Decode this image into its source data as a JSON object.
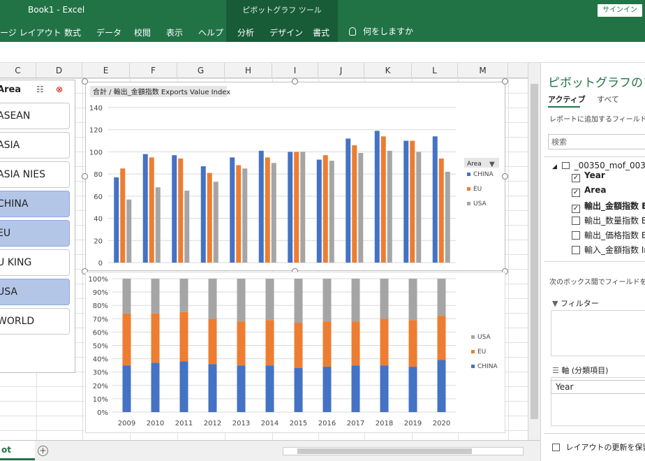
{
  "window": {
    "doc_title": "Book1 - Excel",
    "context_tab_group": "ピボットグラフ ツール",
    "signin": "サインイン"
  },
  "ribbon": {
    "tabs": [
      "ページ レイアウト",
      "数式",
      "データ",
      "校閲",
      "表示",
      "ヘルプ",
      "分析",
      "デザイン",
      "書式"
    ],
    "tell_me": "何をしますか"
  },
  "columns": [
    "C",
    "D",
    "E",
    "F",
    "G",
    "H",
    "I",
    "J",
    "K",
    "L",
    "M"
  ],
  "slicer": {
    "title": "Area",
    "items": [
      {
        "label": "ASEAN",
        "selected": false
      },
      {
        "label": "ASIA",
        "selected": false
      },
      {
        "label": "ASIA NIES",
        "selected": false
      },
      {
        "label": "CHINA",
        "selected": true
      },
      {
        "label": "EU",
        "selected": true
      },
      {
        "label": "U KING",
        "selected": false
      },
      {
        "label": "USA",
        "selected": true
      },
      {
        "label": "WORLD",
        "selected": false
      }
    ]
  },
  "chart_data": [
    {
      "type": "bar",
      "title": "合計 / 輸出_金額指数 Exports Value Index",
      "legend_title": "Area",
      "legend_position": "right",
      "categories": [
        "2009",
        "2010",
        "2011",
        "2012",
        "2013",
        "2014",
        "2015",
        "2016",
        "2017",
        "2018",
        "2019",
        "2020"
      ],
      "series": [
        {
          "name": "CHINA",
          "color": "#4472c4",
          "values": [
            77,
            98,
            97,
            87,
            95,
            101,
            100,
            93,
            112,
            119,
            110,
            114
          ]
        },
        {
          "name": "EU",
          "color": "#ed7d31",
          "values": [
            85,
            95,
            94,
            81,
            88,
            95,
            100,
            97,
            106,
            114,
            110,
            94
          ]
        },
        {
          "name": "USA",
          "color": "#a5a5a5",
          "values": [
            57,
            68,
            65,
            73,
            85,
            90,
            100,
            92,
            99,
            101,
            100,
            82
          ]
        }
      ],
      "ylim": [
        0,
        140
      ],
      "yticks": [
        0,
        20,
        40,
        60,
        80,
        100,
        120,
        140
      ],
      "grid": true
    },
    {
      "type": "bar",
      "stacked_percent": true,
      "legend_position": "right",
      "categories": [
        "2009",
        "2010",
        "2011",
        "2012",
        "2013",
        "2014",
        "2015",
        "2016",
        "2017",
        "2018",
        "2019",
        "2020"
      ],
      "series": [
        {
          "name": "CHINA",
          "color": "#4472c4",
          "values": [
            35,
            37,
            38,
            36,
            35,
            35,
            33,
            34,
            35,
            35,
            34,
            39
          ]
        },
        {
          "name": "EU",
          "color": "#ed7d31",
          "values": [
            39,
            37,
            37,
            34,
            33,
            34,
            34,
            34,
            33,
            35,
            35,
            33
          ]
        },
        {
          "name": "USA",
          "color": "#a5a5a5",
          "values": [
            26,
            26,
            25,
            30,
            32,
            31,
            33,
            32,
            32,
            30,
            31,
            28
          ]
        }
      ],
      "ytick_labels": [
        "0%",
        "10%",
        "20%",
        "30%",
        "40%",
        "50%",
        "60%",
        "70%",
        "80%",
        "90%",
        "100%"
      ],
      "legend_order": [
        "USA",
        "EU",
        "CHINA"
      ],
      "grid": true
    }
  ],
  "pane": {
    "title": "ピボットグラフのフィ",
    "tab_active": "アクティブ",
    "tab_all": "すべて",
    "hint": "レポートに追加するフィールドを選",
    "search_placeholder": "検索",
    "table_name": "_00350_mof_003",
    "fields": [
      {
        "label": "Year",
        "checked": true,
        "bold": true
      },
      {
        "label": "Area",
        "checked": true,
        "bold": true
      },
      {
        "label": "輸出_金額指数 Ex",
        "checked": true,
        "bold": true
      },
      {
        "label": "輸出_数量指数 Ex",
        "checked": false,
        "bold": false
      },
      {
        "label": "輸出_価格指数 Ex",
        "checked": false,
        "bold": false
      },
      {
        "label": "輸入_金額指数 In",
        "checked": false,
        "bold": false
      }
    ],
    "areas_hint": "次のボックス間でフィールドをドラ",
    "filter_label": "フィルター",
    "axis_label": "軸 (分類項目)",
    "axis_value": "Year",
    "defer_label": "レイアウトの更新を保留する"
  },
  "sheet": {
    "tab": "ot",
    "add": "+"
  }
}
